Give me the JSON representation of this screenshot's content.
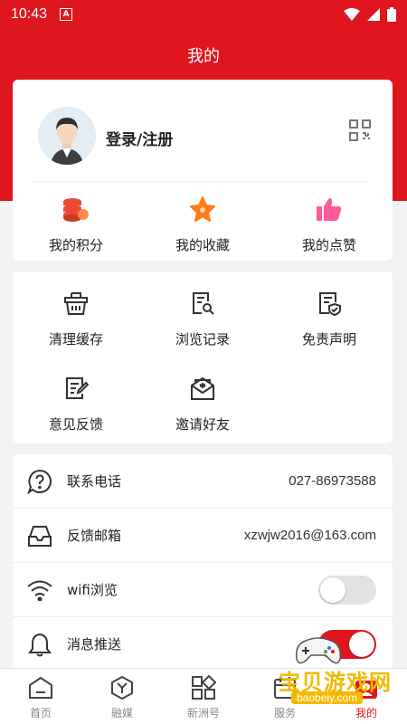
{
  "status_bar": {
    "time": "10:43",
    "notification_letter": "A"
  },
  "header": {
    "title": "我的"
  },
  "profile": {
    "login_label": "登录/注册"
  },
  "stats": [
    {
      "label": "我的积分",
      "icon": "coins-icon"
    },
    {
      "label": "我的收藏",
      "icon": "star-icon"
    },
    {
      "label": "我的点赞",
      "icon": "thumbs-up-icon"
    }
  ],
  "tools": [
    {
      "label": "清理缓存",
      "icon": "basket-icon"
    },
    {
      "label": "浏览记录",
      "icon": "history-doc-icon"
    },
    {
      "label": "免责声明",
      "icon": "disclaimer-doc-icon"
    },
    {
      "label": "意见反馈",
      "icon": "feedback-edit-icon"
    },
    {
      "label": "邀请好友",
      "icon": "invite-mail-icon"
    }
  ],
  "settings": {
    "phone": {
      "label": "联系电话",
      "value": "027-86973588"
    },
    "email": {
      "label": "反馈邮箱",
      "value": "xzwjw2016@163.com"
    },
    "wifi": {
      "label": "wifi浏览",
      "enabled": false
    },
    "push": {
      "label": "消息推送",
      "enabled": true
    }
  },
  "tabs": [
    {
      "label": "首页",
      "icon": "home-icon",
      "active": false
    },
    {
      "label": "融媒",
      "icon": "hexagon-y-icon",
      "active": false
    },
    {
      "label": "新洲号",
      "icon": "grid-icon",
      "active": false
    },
    {
      "label": "服务",
      "icon": "service-icon",
      "active": false
    },
    {
      "label": "我的",
      "icon": "profile-icon",
      "active": true
    }
  ],
  "watermark": {
    "text": "宝贝游戏网",
    "url": "baobeiy.com"
  },
  "colors": {
    "brand_red": "#e0161e",
    "coin_red": "#e84a34",
    "star_orange": "#ff7a1a",
    "thumb_pink": "#ff5a9a",
    "watermark_yellow": "#f2b900"
  }
}
